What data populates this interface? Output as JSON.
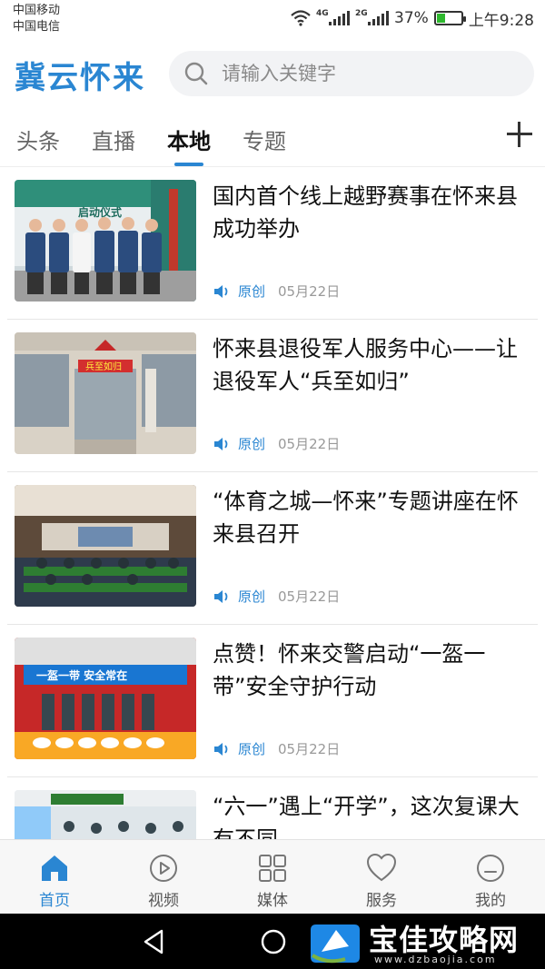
{
  "status_bar": {
    "carrier1": "中国移动",
    "carrier2": "中国电信",
    "sim1_tag": "4G",
    "sim2_tag": "2G",
    "battery_pct": "37%",
    "battery_level": 0.37,
    "time": "上午9:28"
  },
  "header": {
    "app_title": "冀云怀来",
    "search_placeholder": "请输入关键字"
  },
  "tabs": [
    {
      "label": "头条",
      "active": false
    },
    {
      "label": "直播",
      "active": false
    },
    {
      "label": "本地",
      "active": true
    },
    {
      "label": "专题",
      "active": false
    }
  ],
  "news": [
    {
      "title": "国内首个线上越野赛事在怀来县成功举办",
      "source": "原创",
      "date": "05月22日",
      "thumb_text": "启动仪式"
    },
    {
      "title": "怀来县退役军人服务中心——让退役军人“兵至如归”",
      "source": "原创",
      "date": "05月22日",
      "thumb_text": "兵至如归"
    },
    {
      "title": "“体育之城—怀来”专题讲座在怀来县召开",
      "source": "原创",
      "date": "05月22日",
      "thumb_text": ""
    },
    {
      "title": "点赞！怀来交警启动“一盔一带”安全守护行动",
      "source": "原创",
      "date": "05月22日",
      "thumb_text": "一盔一带 安全常在"
    },
    {
      "title": "“六一”遇上“开学”，这次复课大有不同",
      "source": "",
      "date": "",
      "thumb_text": ""
    }
  ],
  "bottom_nav": [
    {
      "label": "首页",
      "icon": "home-icon",
      "active": true
    },
    {
      "label": "视频",
      "icon": "play-icon",
      "active": false
    },
    {
      "label": "媒体",
      "icon": "grid-icon",
      "active": false
    },
    {
      "label": "服务",
      "icon": "heart-icon",
      "active": false
    },
    {
      "label": "我的",
      "icon": "user-icon",
      "active": false
    }
  ],
  "watermark": {
    "title": "宝佳攻略网",
    "url": "www.dzbaojia.com"
  },
  "colors": {
    "accent": "#2a86d2",
    "text": "#111111",
    "muted": "#999999"
  }
}
